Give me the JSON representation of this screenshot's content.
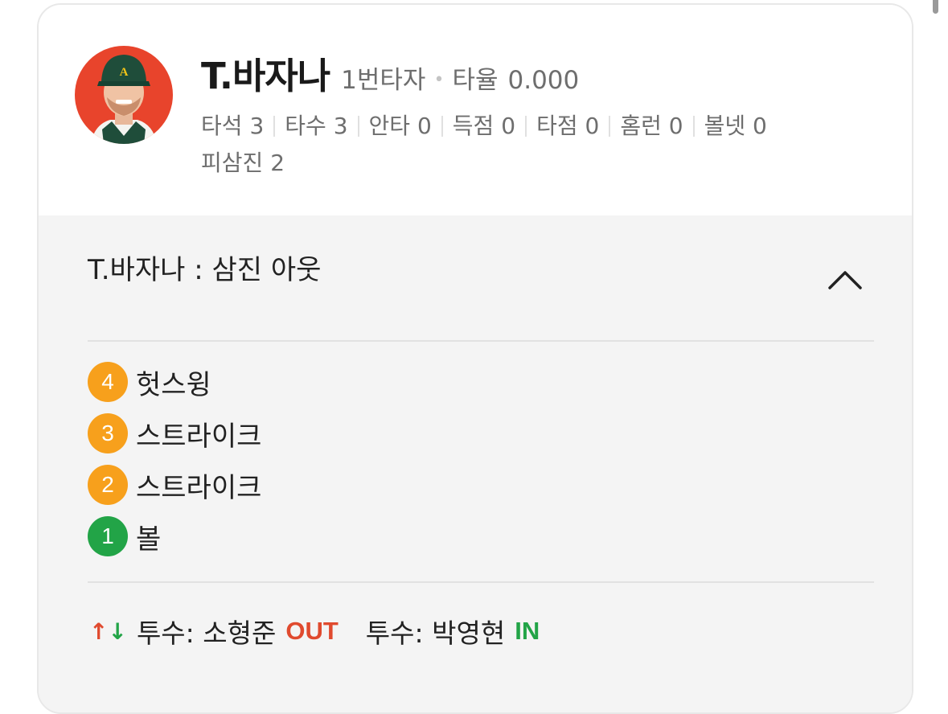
{
  "player": {
    "name": "T.바자나",
    "batting_order": "1번타자",
    "avg_label": "타율",
    "avg_value": "0.000",
    "stats": [
      {
        "label": "타석",
        "value": "3"
      },
      {
        "label": "타수",
        "value": "3"
      },
      {
        "label": "안타",
        "value": "0"
      },
      {
        "label": "득점",
        "value": "0"
      },
      {
        "label": "타점",
        "value": "0"
      },
      {
        "label": "홈런",
        "value": "0"
      },
      {
        "label": "볼넷",
        "value": "0"
      },
      {
        "label": "피삼진",
        "value": "2"
      }
    ]
  },
  "at_bat": {
    "result": "T.바자나 : 삼진 아웃",
    "toggle_icon": "chevron-up-icon",
    "pitches": [
      {
        "number": "4",
        "label": "헛스윙",
        "color": "#f7a01c"
      },
      {
        "number": "3",
        "label": "스트라이크",
        "color": "#f7a01c"
      },
      {
        "number": "2",
        "label": "스트라이크",
        "color": "#f7a01c"
      },
      {
        "number": "1",
        "label": "볼",
        "color": "#22a447"
      }
    ]
  },
  "substitution": {
    "icon": "swap-arrows-icon",
    "out_text": "투수: 소형준",
    "out_tag": "OUT",
    "in_text": "투수: 박영현",
    "in_tag": "IN"
  },
  "colors": {
    "out": "#e04a2e",
    "in": "#22a447",
    "strike": "#f7a01c",
    "ball": "#22a447"
  }
}
